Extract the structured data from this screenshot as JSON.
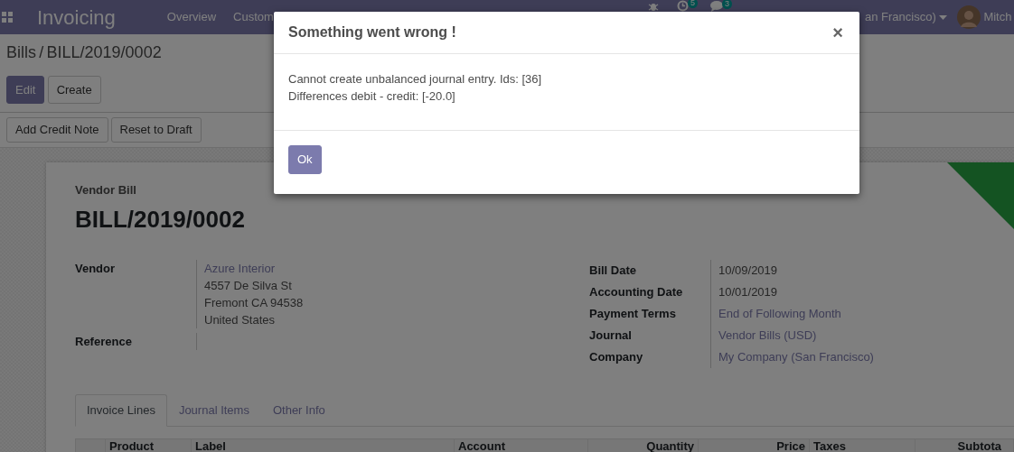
{
  "navbar": {
    "app_name": "Invoicing",
    "menu": [
      "Overview",
      "Custom"
    ],
    "activity_count": "5",
    "message_count": "3",
    "company": "an Francisco)",
    "user": "Mitch"
  },
  "breadcrumb": {
    "items": [
      "Bills",
      "BILL/2019/0002"
    ],
    "separator": "/"
  },
  "control_buttons": [
    {
      "label": "Edit",
      "kind": "primary"
    },
    {
      "label": "Create",
      "kind": "secondary"
    }
  ],
  "status_buttons": [
    "Add Credit Note",
    "Reset to Draft"
  ],
  "sheet": {
    "doc_type": "Vendor Bill",
    "title": "BILL/2019/0002",
    "left_fields": [
      {
        "label": "Vendor",
        "lines": [
          {
            "text": "Azure Interior",
            "kind": "link"
          },
          {
            "text": "4557 De Silva St",
            "kind": "text"
          },
          {
            "text": "Fremont CA 94538",
            "kind": "text"
          },
          {
            "text": "United States",
            "kind": "text"
          }
        ]
      },
      {
        "label": "Reference"
      }
    ],
    "right_fields": [
      {
        "label": "Bill Date",
        "value": "10/09/2019",
        "kind": "text"
      },
      {
        "label": "Accounting Date",
        "value": "10/01/2019",
        "kind": "text"
      },
      {
        "label": "Payment Terms",
        "value": "End of Following Month",
        "kind": "link"
      },
      {
        "label": "Journal",
        "value": "Vendor Bills (USD)",
        "kind": "link"
      },
      {
        "label": "Company",
        "value": "My Company (San Francisco)",
        "kind": "link"
      }
    ],
    "tabs": [
      {
        "label": "Invoice Lines",
        "selected": true
      },
      {
        "label": "Journal Items",
        "selected": false
      },
      {
        "label": "Other Info",
        "selected": false
      }
    ],
    "columns": [
      {
        "label": "Product",
        "kind": "text"
      },
      {
        "label": "Label",
        "kind": "text"
      },
      {
        "label": "Account",
        "kind": "text"
      },
      {
        "label": "Quantity",
        "kind": "number"
      },
      {
        "label": "Price",
        "kind": "number"
      },
      {
        "label": "Taxes",
        "kind": "text"
      },
      {
        "label": "Subtota",
        "kind": "number"
      }
    ]
  },
  "dialog": {
    "title": "Something went wrong !",
    "close": "×",
    "messages": [
      "Cannot create unbalanced journal entry. Ids: [36]",
      "Differences debit - credit: [-20.0]"
    ],
    "ok_button": "Ok"
  }
}
